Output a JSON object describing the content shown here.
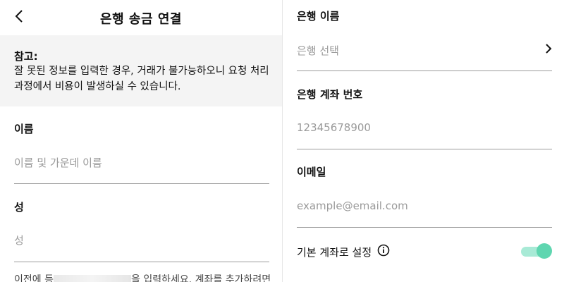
{
  "header": {
    "title": "은행 송금 연결"
  },
  "notice": {
    "label": "참고:",
    "text": "잘 못된 정보를 입력한 경우, 거래가 불가능하오니 요청 처리 과정에서 비용이 발생하실 수 있습니다."
  },
  "form_left": {
    "first_name_label": "이름",
    "first_name_placeholder": "이름 및 가운데 이름",
    "last_name_label": "성",
    "last_name_placeholder": "성",
    "bottom_text_start": "이전에 등",
    "bottom_text_end": "을 입력하세요. 계좌를 추가하려면"
  },
  "form_right": {
    "bank_name_label": "은행 이름",
    "bank_select_placeholder": "은행 선택",
    "account_number_label": "은행 계좌 번호",
    "account_number_placeholder": "12345678900",
    "email_label": "이메일",
    "email_placeholder": "example@email.com",
    "default_toggle_label": "기본 계좌로 설정",
    "default_toggle_on": true
  },
  "colors": {
    "toggle_track": "#a8ead6",
    "toggle_knob": "#5fd6b0",
    "notice_bg": "#f4f4f4"
  }
}
